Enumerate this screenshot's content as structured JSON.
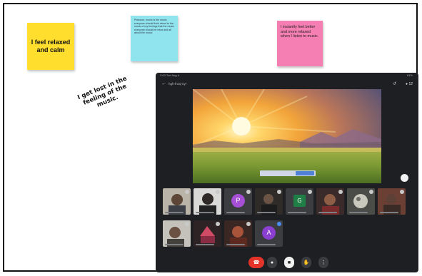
{
  "board": {
    "note_yellow": "I feel relaxed and calm",
    "note_cyan": "Pleasure, music is the music everyone should think about to the music of my feelings that the music everyone should be relax and all about the music",
    "note_pink": "I instantly feel better and more relaxed when I listen to music.",
    "handwritten": "I get lost in the feeling of the music."
  },
  "meeting": {
    "status_time": "3:03 Tue Aug 4",
    "status_battery": "81%",
    "meeting_code": "hgh-fnzq-uyr",
    "participant_count": "12",
    "avatars": [
      {
        "letter": "P",
        "color": "#a44fd6"
      },
      {
        "letter": "G",
        "color": "#1f7f46"
      },
      {
        "letter": "A",
        "color": "#8a3fd0"
      }
    ]
  },
  "icons": {
    "back": "arrow-back-icon",
    "switch_camera": "switch-camera-icon",
    "people": "people-icon",
    "end_call": "call-end-icon",
    "mic": "mic-icon",
    "camera": "camera-icon",
    "raise_hand": "raise-hand-icon",
    "more": "more-vert-icon"
  }
}
